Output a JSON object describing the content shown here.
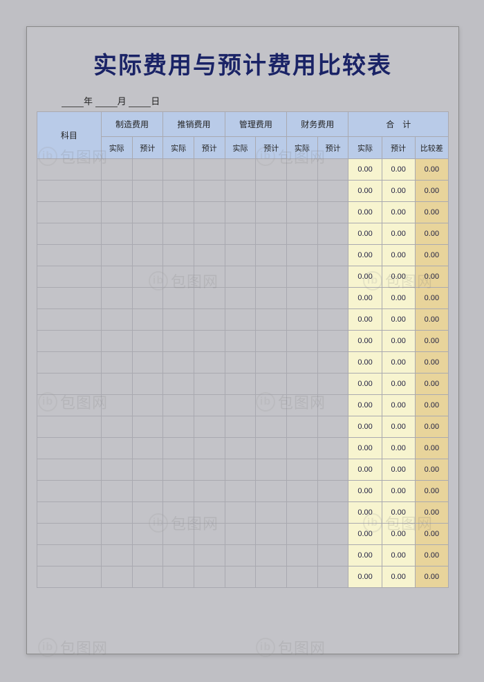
{
  "title": "实际费用与预计费用比较表",
  "date": {
    "year": "年",
    "month": "月",
    "day": "日"
  },
  "header": {
    "subject": "科目",
    "groups": [
      "制造费用",
      "推销费用",
      "管理费用",
      "财务费用"
    ],
    "total_label": "合　计",
    "sub_actual": "实际",
    "sub_planned": "预计",
    "sub_diff": "比较差"
  },
  "rows": [
    {
      "a": "",
      "p": "",
      "sa": "0.00",
      "sp": "0.00",
      "sd": "0.00"
    },
    {
      "a": "",
      "p": "",
      "sa": "0.00",
      "sp": "0.00",
      "sd": "0.00"
    },
    {
      "a": "",
      "p": "",
      "sa": "0.00",
      "sp": "0.00",
      "sd": "0.00"
    },
    {
      "a": "",
      "p": "",
      "sa": "0.00",
      "sp": "0.00",
      "sd": "0.00"
    },
    {
      "a": "",
      "p": "",
      "sa": "0.00",
      "sp": "0.00",
      "sd": "0.00"
    },
    {
      "a": "",
      "p": "",
      "sa": "0.00",
      "sp": "0.00",
      "sd": "0.00"
    },
    {
      "a": "",
      "p": "",
      "sa": "0.00",
      "sp": "0.00",
      "sd": "0.00"
    },
    {
      "a": "",
      "p": "",
      "sa": "0.00",
      "sp": "0.00",
      "sd": "0.00"
    },
    {
      "a": "",
      "p": "",
      "sa": "0.00",
      "sp": "0.00",
      "sd": "0.00"
    },
    {
      "a": "",
      "p": "",
      "sa": "0.00",
      "sp": "0.00",
      "sd": "0.00"
    },
    {
      "a": "",
      "p": "",
      "sa": "0.00",
      "sp": "0.00",
      "sd": "0.00"
    },
    {
      "a": "",
      "p": "",
      "sa": "0.00",
      "sp": "0.00",
      "sd": "0.00"
    },
    {
      "a": "",
      "p": "",
      "sa": "0.00",
      "sp": "0.00",
      "sd": "0.00"
    },
    {
      "a": "",
      "p": "",
      "sa": "0.00",
      "sp": "0.00",
      "sd": "0.00"
    },
    {
      "a": "",
      "p": "",
      "sa": "0.00",
      "sp": "0.00",
      "sd": "0.00"
    },
    {
      "a": "",
      "p": "",
      "sa": "0.00",
      "sp": "0.00",
      "sd": "0.00"
    },
    {
      "a": "",
      "p": "",
      "sa": "0.00",
      "sp": "0.00",
      "sd": "0.00"
    },
    {
      "a": "",
      "p": "",
      "sa": "0.00",
      "sp": "0.00",
      "sd": "0.00"
    },
    {
      "a": "",
      "p": "",
      "sa": "0.00",
      "sp": "0.00",
      "sd": "0.00"
    },
    {
      "a": "",
      "p": "",
      "sa": "0.00",
      "sp": "0.00",
      "sd": "0.00"
    }
  ],
  "watermark_text": "包图网"
}
